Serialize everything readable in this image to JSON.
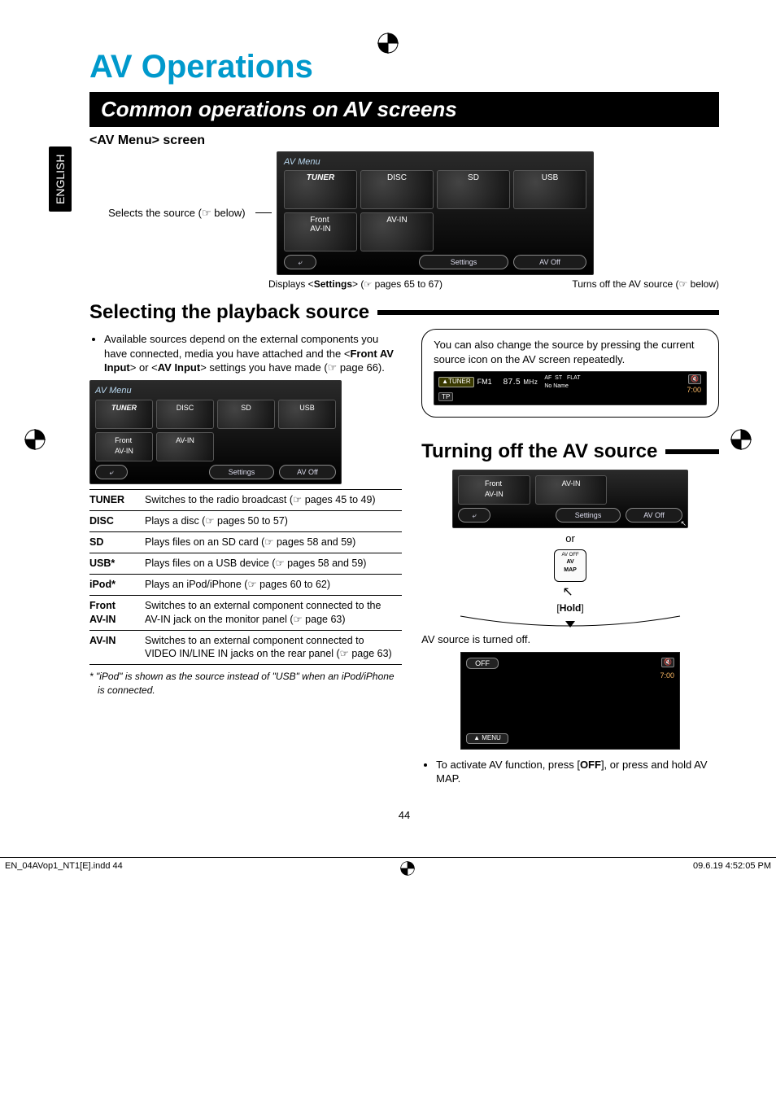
{
  "meta": {
    "language_tab": "ENGLISH",
    "page_number": "44",
    "footer_left": "EN_04AVop1_NT1[E].indd   44",
    "footer_right": "09.6.19   4:52:05 PM"
  },
  "titles": {
    "page_title": "AV Operations",
    "section_bar": "Common operations on AV screens",
    "av_menu_heading": "<AV Menu> screen",
    "selecting_source": "Selecting the playback source",
    "turning_off": "Turning off the AV source"
  },
  "av_menu": {
    "selects_label": "Selects the source (☞ below)",
    "screen_title": "AV Menu",
    "sources": {
      "tuner": "TUNER",
      "disc": "DISC",
      "sd": "SD",
      "usb": "USB",
      "front_avin_l1": "Front",
      "front_avin_l2": "AV-IN",
      "avin": "AV-IN"
    },
    "buttons": {
      "back": "⤶",
      "settings": "Settings",
      "av_off": "AV Off"
    },
    "caption_settings": "Displays <Settings> (☞ pages 65 to 67)",
    "caption_avoff": "Turns off the AV source (☞ below)"
  },
  "selecting": {
    "bullet1_pre": "Available sources depend on the external components you have connected, media you have attached and the <",
    "bullet1_b1": "Front AV Input",
    "bullet1_mid": "> or <",
    "bullet1_b2": "AV Input",
    "bullet1_post": "> settings you have made (☞ page 66).",
    "table": {
      "tuner": {
        "label": "TUNER",
        "desc": "Switches to the radio broadcast (☞ pages 45 to 49)"
      },
      "disc": {
        "label": "DISC",
        "desc": "Plays a disc (☞ pages 50 to 57)"
      },
      "sd": {
        "label": "SD",
        "desc": "Plays files on an SD card (☞ pages 58 and 59)"
      },
      "usb": {
        "label": "USB*",
        "desc": "Plays files on a USB device (☞ pages 58 and 59)"
      },
      "ipod": {
        "label": "iPod*",
        "desc": "Plays an iPod/iPhone (☞ pages 60 to 62)"
      },
      "front_avin": {
        "label_l1": "Front",
        "label_l2": "AV-IN",
        "desc": "Switches to an external component connected to the AV-IN jack on the monitor panel (☞ page 63)"
      },
      "avin": {
        "label": "AV-IN",
        "desc": "Switches to an external component connected to VIDEO IN/LINE IN jacks on the rear panel (☞ page 63)"
      }
    },
    "footnote": "*  \"iPod\" is shown as the source instead of \"USB\" when an iPod/iPhone is connected."
  },
  "tip_box": {
    "text": "You can also change the source by pressing the current source icon on the AV screen repeatedly.",
    "tuner_bar": {
      "tuner_chip": "TUNER",
      "band": "FM1",
      "freq": "87.5",
      "unit": "MHz",
      "af": "AF",
      "st": "ST",
      "flat": "FLAT",
      "noname": "No Name",
      "tp": "TP",
      "clock": "7:00",
      "vol": "🔇"
    }
  },
  "turning_off": {
    "front_avin_l1": "Front",
    "front_avin_l2": "AV-IN",
    "avin": "AV-IN",
    "back": "⤶",
    "settings": "Settings",
    "av_off": "AV Off",
    "or": "or",
    "avmap_top": "AV OFF",
    "avmap_l1": "AV",
    "avmap_l2": "MAP",
    "hold": "[Hold]",
    "result": "AV source is turned off.",
    "off_chip": "OFF",
    "vol": "🔇",
    "clock": "7:00",
    "menu_chip": "▲ MENU",
    "reactivate_pre": "To activate AV function, press [",
    "reactivate_b": "OFF",
    "reactivate_post": "], or press and hold AV MAP."
  }
}
